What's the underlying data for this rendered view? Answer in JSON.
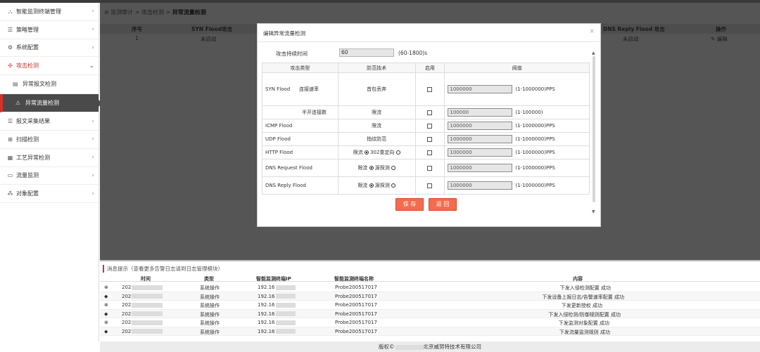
{
  "sidebar": {
    "items": [
      {
        "label": "智能监测终端管理"
      },
      {
        "label": "策略管理"
      },
      {
        "label": "系统配置"
      },
      {
        "label": "攻击检测"
      },
      {
        "label": "异常报文检测"
      },
      {
        "label": "异常流量检测"
      },
      {
        "label": "报文采集结果"
      },
      {
        "label": "扫描检测"
      },
      {
        "label": "工艺异常检测"
      },
      {
        "label": "流量监测"
      },
      {
        "label": "对象配置"
      }
    ]
  },
  "breadcrumb": {
    "part1": "监测审计",
    "sep": ">",
    "part2": "攻击检测",
    "part3": "异常流量检测"
  },
  "bg_table": {
    "headers": [
      "序号",
      "SYN Flood攻击",
      "DNS Reply Flood 攻击",
      "操作"
    ],
    "row": [
      "1",
      "未启动",
      "未启动",
      "编辑"
    ]
  },
  "modal": {
    "title": "编辑异常流量检测",
    "close": "×",
    "duration_label": "攻击持续时间",
    "duration_value": "60",
    "duration_hint": "(60-1800)s",
    "headers": [
      "攻击类型",
      "防范技术",
      "启用",
      "阈值"
    ],
    "syn_label": "SYN Flood",
    "rows": [
      {
        "sub": "连接速率",
        "tech": "首包丢弃",
        "threshold": "1000000",
        "hint": "(1-1000000)PPS"
      },
      {
        "sub": "半开连接数",
        "tech": "限流",
        "threshold": "100000",
        "hint": "(1-100000)"
      },
      {
        "type": "ICMP Flood",
        "tech": "限流",
        "threshold": "1000000",
        "hint": "(1-1000000)PPS"
      },
      {
        "type": "UDP Flood",
        "tech": "指纹防范",
        "threshold": "1000000",
        "hint": "(1-1000000)PPS"
      },
      {
        "type": "HTTP Flood",
        "tech_a": "限流",
        "tech_b": "302重定向",
        "threshold": "1000000",
        "hint": "(1-1000000)PPS"
      },
      {
        "type": "DNS Request Flood",
        "tech_a": "限流",
        "tech_b": "源探测",
        "threshold": "1000000",
        "hint": "(1-1000000)PPS"
      },
      {
        "type": "DNS Reply Flood",
        "tech_a": "限流",
        "tech_b": "源探测",
        "threshold": "1000000",
        "hint": "(1-1000000)PPS"
      }
    ],
    "save": "保 存",
    "back": "返 回"
  },
  "messages": {
    "title": "消息提示（查看更多告警日志请到日志管理模块）",
    "headers": [
      "时间",
      "类型",
      "智能监测终端IP",
      "智能监测终端名称",
      "内容"
    ],
    "rows": [
      {
        "time": "202",
        "type": "系统操作",
        "ip": "192.16",
        "name": "Probe200517017",
        "content": "下发入侵检测配置 成功"
      },
      {
        "time": "202",
        "type": "系统操作",
        "ip": "192.16",
        "name": "Probe200517017",
        "content": "下发设备上报日志/告警速率配置 成功"
      },
      {
        "time": "202",
        "type": "系统操作",
        "ip": "192.16",
        "name": "Probe200517017",
        "content": "下发更新授权 成功"
      },
      {
        "time": "202",
        "type": "系统操作",
        "ip": "192.16",
        "name": "Probe200517017",
        "content": "下发入侵检测/防御规则配置 成功"
      },
      {
        "time": "202",
        "type": "系统操作",
        "ip": "192.16",
        "name": "Probe200517017",
        "content": "下发监测对象配置 成功"
      },
      {
        "time": "202",
        "type": "系统操作",
        "ip": "192.16",
        "name": "Probe200517017",
        "content": "下发流量监测规则 成功"
      }
    ]
  },
  "footer": {
    "prefix": "版权©",
    "suffix": "北京威努特技术有限公司"
  }
}
